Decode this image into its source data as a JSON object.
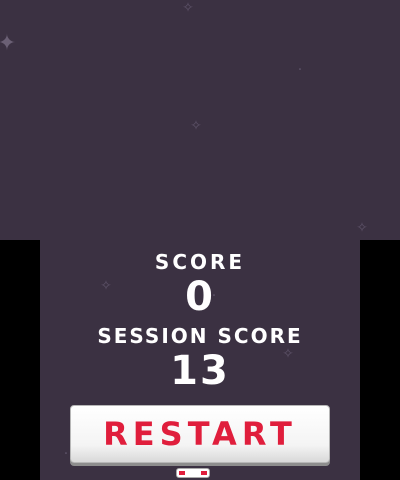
{
  "game": {
    "score_label": "SCORE",
    "score_value": "0",
    "session_label": "SESSION SCORE",
    "session_value": "13",
    "restart_label": "RESTART"
  },
  "colors": {
    "background": "#3b3142",
    "letterbox": "#000000",
    "text": "#ffffff",
    "accent_red": "#e01e3c"
  },
  "icons": [
    "sparkle-icon",
    "stylus-icon"
  ]
}
